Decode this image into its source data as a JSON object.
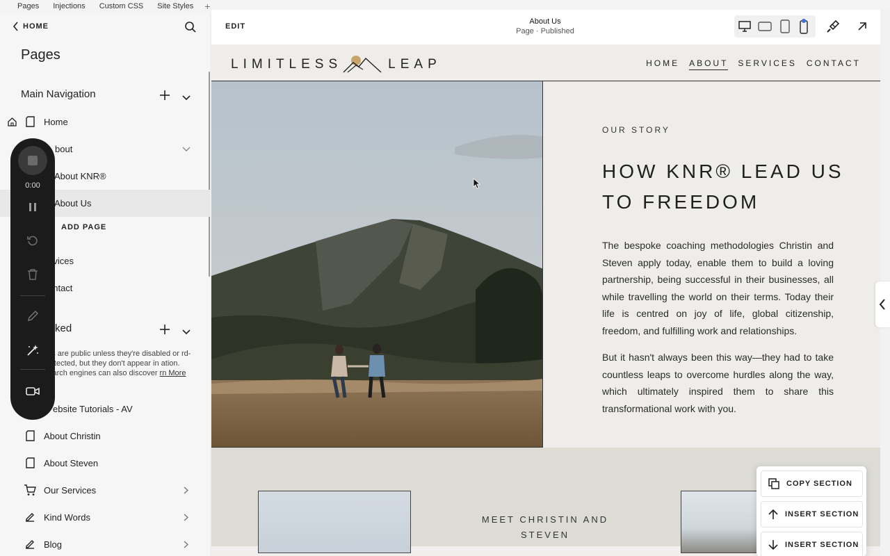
{
  "tabs": [
    "Pages",
    "Injections",
    "Custom CSS",
    "Site Styles"
  ],
  "tab_add": "+",
  "left_panel": {
    "back_label": "HOME",
    "title": "Pages",
    "main_nav_title": "Main Navigation",
    "items": [
      {
        "label": "Home"
      },
      {
        "label": "bout"
      },
      {
        "label": "About KNR®"
      },
      {
        "label": "About Us"
      },
      {
        "label": "rvices"
      },
      {
        "label": "ontact"
      }
    ],
    "add_page": "ADD PAGE",
    "not_linked_title": "ked",
    "not_linked_desc": "ges are public unless they're disabled or rd-protected, but they don't appear in ation. Search engines can also discover",
    "learn_more": "rn More",
    "unlinked_items": [
      {
        "label": "ebsite Tutorials - AV"
      },
      {
        "label": "About Christin"
      },
      {
        "label": "About Steven"
      },
      {
        "label": "Our Services"
      },
      {
        "label": "Kind Words"
      },
      {
        "label": "Blog"
      }
    ]
  },
  "recorder": {
    "time": "0:00"
  },
  "editor": {
    "edit_label": "EDIT",
    "page_title": "About Us",
    "page_subtitle": "Page · Published"
  },
  "site": {
    "logo_left": "LIMITLESS",
    "logo_right": "LEAP",
    "nav": [
      "HOME",
      "ABOUT",
      "SERVICES",
      "CONTACT"
    ],
    "eyebrow": "OUR STORY",
    "title": "HOW KNR® LEAD US TO FREEDOM",
    "p1": "The bespoke coaching methodologies Christin and Steven apply today, enable them to build a loving partnership, being successful in their businesses, all while travelling the world on their terms. Today their life is centred on joy of life, global citizenship, freedom, and fulfilling work and relationships.",
    "p2": "But it hasn't always been this way—they had to take countless leaps to overcome hurdles along the way, which ultimately inspired them to share this transformational work with you.",
    "meet": "MEET CHRISTIN AND STEVEN"
  },
  "section_menu": {
    "copy": "COPY SECTION",
    "insert": "INSERT SECTION",
    "insert2": "INSERT SECTION"
  }
}
